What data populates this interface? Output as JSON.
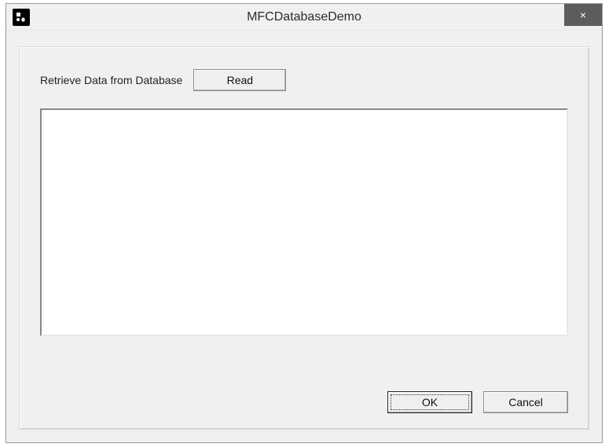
{
  "window": {
    "title": "MFCDatabaseDemo"
  },
  "toolbar": {
    "retrieve_label": "Retrieve Data from Database",
    "read_label": "Read"
  },
  "list": {
    "items": []
  },
  "buttons": {
    "ok_label": "OK",
    "cancel_label": "Cancel"
  },
  "titlebar": {
    "close_glyph": "×"
  }
}
